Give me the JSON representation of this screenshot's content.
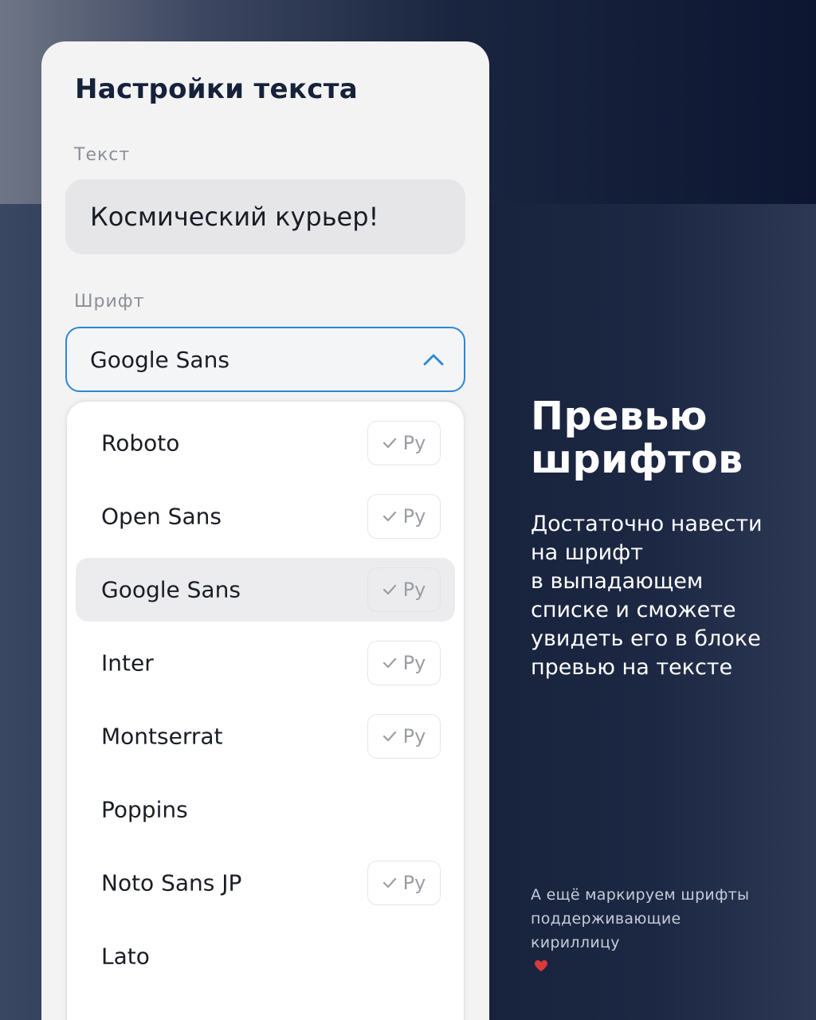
{
  "panel": {
    "title": "Настройки текста",
    "text_label": "Текст",
    "text_value": "Космический курьер!",
    "font_label": "Шрифт",
    "selected_font": "Google Sans"
  },
  "dropdown": {
    "options": [
      {
        "name": "Roboto",
        "cyrillic": true,
        "badge": "Ру",
        "highlighted": false
      },
      {
        "name": "Open Sans",
        "cyrillic": true,
        "badge": "Ру",
        "highlighted": false
      },
      {
        "name": "Google Sans",
        "cyrillic": true,
        "badge": "Ру",
        "highlighted": true
      },
      {
        "name": "Inter",
        "cyrillic": true,
        "badge": "Ру",
        "highlighted": false
      },
      {
        "name": "Montserrat",
        "cyrillic": true,
        "badge": "Ру",
        "highlighted": false
      },
      {
        "name": "Poppins",
        "cyrillic": false,
        "badge": "",
        "highlighted": false
      },
      {
        "name": "Noto Sans JP",
        "cyrillic": true,
        "badge": "Ру",
        "highlighted": false
      },
      {
        "name": "Lato",
        "cyrillic": false,
        "badge": "",
        "highlighted": false
      }
    ]
  },
  "promo": {
    "heading_line1": "Превью",
    "heading_line2": "шрифтов",
    "desc_lines": [
      "Достаточно навести",
      "на шрифт",
      "в выпадающем",
      "списке и сможете",
      "увидеть его в блоке",
      "превью на тексте"
    ],
    "note_lines": [
      "А ещё маркируем шрифты",
      "поддерживающие",
      "кириллицу"
    ]
  },
  "colors": {
    "accent_border": "#2b87d6",
    "panel_bg": "#f3f3f4",
    "heart": "#d93a3a"
  },
  "icons": {
    "dropdown_toggle": "chevron-up-icon",
    "badge_check": "check-icon",
    "note_emoji": "heart-icon"
  }
}
